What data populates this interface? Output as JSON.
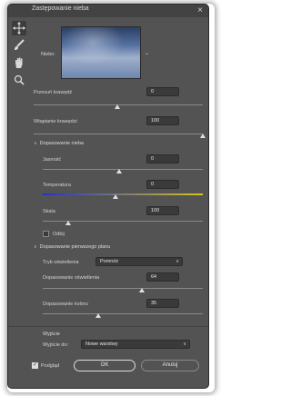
{
  "window": {
    "title": "Zastępowanie nieba",
    "close_glyph": "×"
  },
  "toolbar": {
    "tools": [
      "move-tool-icon",
      "brush-tool-icon",
      "hand-tool-icon",
      "zoom-tool-icon"
    ]
  },
  "sky": {
    "label": "Niebo:",
    "arrow": "⌄"
  },
  "shift_edge": {
    "label": "Przesuń krawędź",
    "value": "0",
    "level": 0.5
  },
  "fade_edge": {
    "label": "Wtapianie krawędzi",
    "value": "100",
    "level": 1.0
  },
  "sky_adjust": {
    "header": "Dopasowanie nieba",
    "brightness": {
      "label": "Jasność",
      "value": "0",
      "level": 0.5
    },
    "temperature": {
      "label": "Temperatura",
      "value": "0",
      "level": 0.5
    },
    "scale": {
      "label": "Skala",
      "value": "100",
      "level": 0.2
    },
    "flip": {
      "label": "Odbij",
      "checked": false
    }
  },
  "foreground": {
    "header": "Dopasowanie pierwszego planu",
    "mode_label": "Tryb oświetlenia",
    "mode_value": "Pomnóż",
    "lighting": {
      "label": "Dopasowanie oświetlenia",
      "value": "64",
      "level": 0.64
    },
    "color": {
      "label": "Dopasowanie koloru",
      "value": "35",
      "level": 0.35
    }
  },
  "output": {
    "header": "Wyjście",
    "label": "Wyjście do:",
    "value": "Nowe warstwy"
  },
  "footer": {
    "preview_label": "Podgląd",
    "ok": "OK",
    "cancel": "Anuluj"
  }
}
